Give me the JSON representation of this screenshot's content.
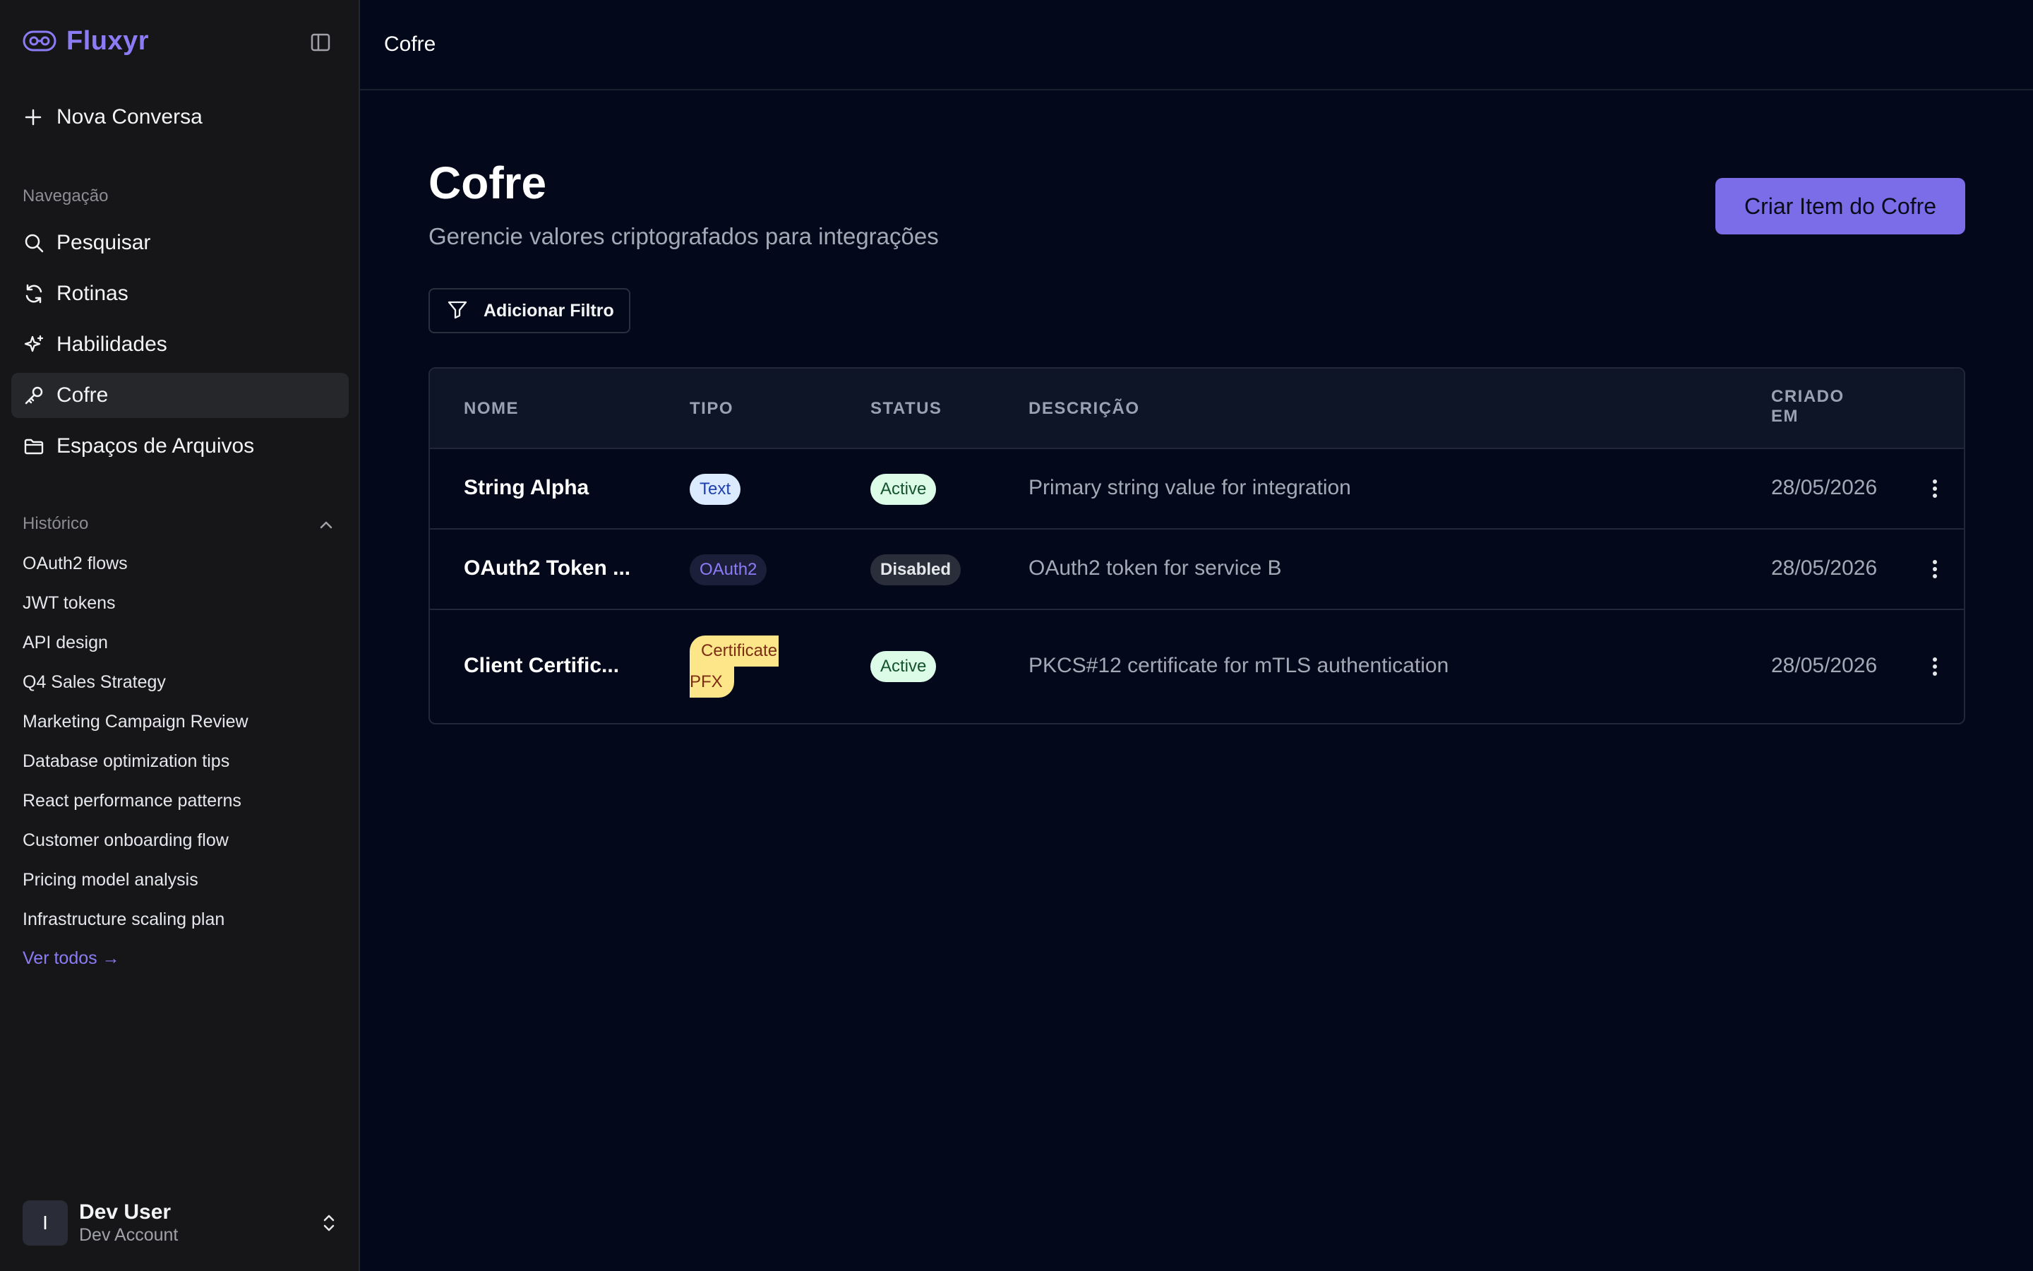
{
  "brand": {
    "name": "Fluxyr",
    "accent": "#8b7cf6"
  },
  "sidebar": {
    "new_chat_label": "Nova Conversa",
    "nav_label": "Navegação",
    "nav_items": [
      {
        "label": "Pesquisar",
        "icon": "search-icon"
      },
      {
        "label": "Rotinas",
        "icon": "refresh-icon"
      },
      {
        "label": "Habilidades",
        "icon": "sparkle-icon"
      },
      {
        "label": "Cofre",
        "icon": "key-icon",
        "active": true
      },
      {
        "label": "Espaços de Arquivos",
        "icon": "folder-icon"
      }
    ],
    "history_label": "Histórico",
    "history": [
      "OAuth2 flows",
      "JWT tokens",
      "API design",
      "Q4 Sales Strategy",
      "Marketing Campaign Review",
      "Database optimization tips",
      "React performance patterns",
      "Customer onboarding flow",
      "Pricing model analysis",
      "Infrastructure scaling plan"
    ],
    "see_all": "Ver todos →"
  },
  "user": {
    "initial": "I",
    "name": "Dev User",
    "account": "Dev Account"
  },
  "topbar": {
    "title": "Cofre"
  },
  "page": {
    "title": "Cofre",
    "subtitle": "Gerencie valores criptografados para integrações",
    "create_button": "Criar Item do Cofre",
    "filter_button": "Adicionar Filtro"
  },
  "table": {
    "headers": {
      "name": "NOME",
      "type": "TIPO",
      "status": "STATUS",
      "description": "DESCRIÇÃO",
      "created_1": "CRIADO",
      "created_2": "EM"
    },
    "rows": [
      {
        "name": "String Alpha",
        "type": "Text",
        "status": "Active",
        "description": "Primary string value for integration",
        "created": "28/05/2026"
      },
      {
        "name": "OAuth2 Token ...",
        "type": "OAuth2",
        "status": "Disabled",
        "description": "OAuth2 token for service B",
        "created": "28/05/2026"
      },
      {
        "name": "Client Certific...",
        "type_1": "Certificate",
        "type_2": "PFX",
        "status": "Active",
        "description": "PKCS#12 certificate for mTLS authentication",
        "created": "28/05/2026"
      }
    ]
  }
}
